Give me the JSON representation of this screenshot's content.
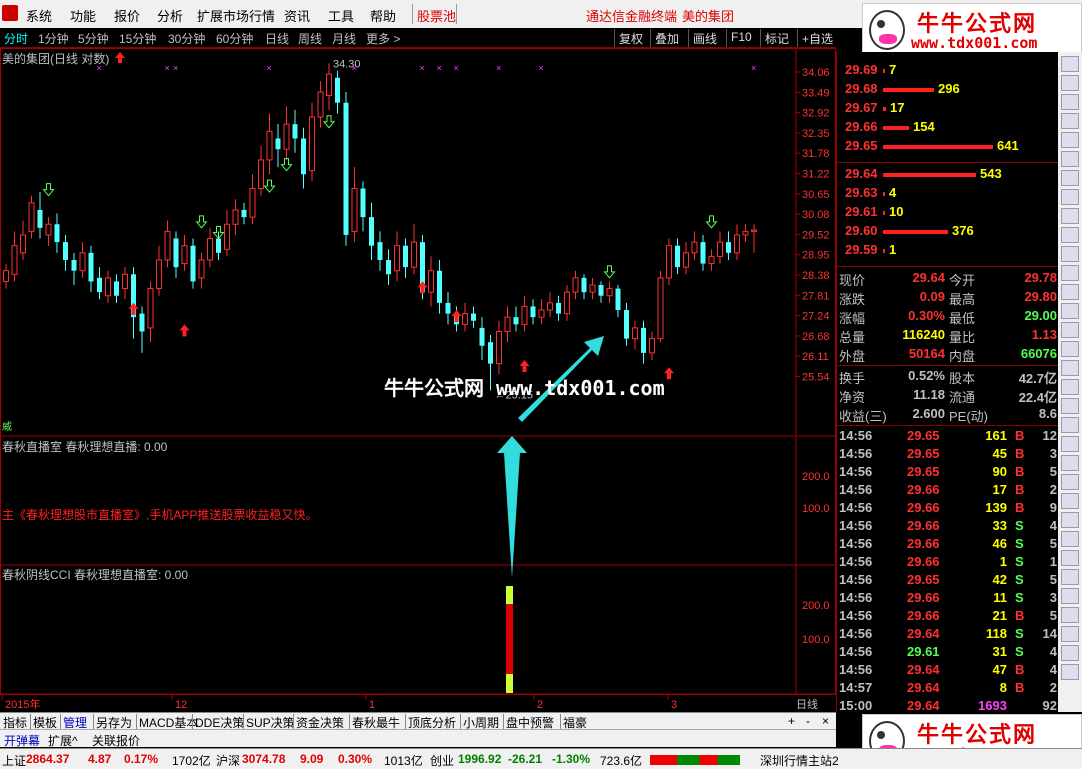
{
  "menu": {
    "items": [
      "系统",
      "功能",
      "报价",
      "分析",
      "扩展市场行情",
      "资讯",
      "工具",
      "帮助"
    ],
    "highlight": "股票池",
    "center_title": "通达信金融终端",
    "stock_name": "美的集团"
  },
  "brand": {
    "title": "牛牛公式网",
    "url": "www.tdx001.com"
  },
  "period_bar": {
    "periods": [
      "分时",
      "1分钟",
      "5分钟",
      "15分钟",
      "30分钟",
      "60分钟",
      "日线",
      "周线",
      "月线",
      "更多 >"
    ],
    "active": "分时",
    "buttons": [
      "复权",
      "叠加",
      "画线",
      "F10",
      "标记",
      "+自选"
    ]
  },
  "chart_title": "美的集团(日线 对数)",
  "watermark": "牛牛公式网 www.tdx001.com",
  "chart_data": {
    "type": "candlestick",
    "price_axis": [
      "34.06",
      "33.49",
      "32.92",
      "32.35",
      "31.78",
      "31.22",
      "30.65",
      "30.08",
      "29.52",
      "28.95",
      "28.38",
      "27.81",
      "27.24",
      "26.68",
      "26.11",
      "25.54"
    ],
    "high_label": "34.30",
    "low_label": "25.15",
    "indicator1": {
      "title": "春秋直播室  春秋理想直播: 0.00",
      "axis": [
        "200.0",
        "100.0"
      ]
    },
    "indicator2": {
      "title": "春秋阴线CCI  春秋理想直播室: 0.00",
      "axis": [
        "200.0",
        "100.0"
      ]
    },
    "x_labels": [
      "2015年",
      "12",
      "1",
      "2",
      "3"
    ],
    "period_label": "日线"
  },
  "promo_text": "主《春秋理想股市直播室》,手机APP推送股票收益稳又快。",
  "order_book": {
    "asks": [
      {
        "price": "29.69",
        "vol": "7"
      },
      {
        "price": "29.68",
        "vol": "296"
      },
      {
        "price": "29.67",
        "vol": "17"
      },
      {
        "price": "29.66",
        "vol": "154"
      },
      {
        "price": "29.65",
        "vol": "641"
      }
    ],
    "bids": [
      {
        "price": "29.64",
        "vol": "543"
      },
      {
        "price": "29.63",
        "vol": "4"
      },
      {
        "price": "29.61",
        "vol": "10"
      },
      {
        "price": "29.60",
        "vol": "376"
      },
      {
        "price": "29.59",
        "vol": "1"
      }
    ]
  },
  "quote": {
    "rows": [
      {
        "l1": "现价",
        "v1": "29.64",
        "l2": "今开",
        "v2": "29.78"
      },
      {
        "l1": "涨跌",
        "v1": "0.09",
        "l2": "最高",
        "v2": "29.80"
      },
      {
        "l1": "涨幅",
        "v1": "0.30%",
        "l2": "最低",
        "v2": "29.00"
      },
      {
        "l1": "总量",
        "v1": "116240",
        "l2": "量比",
        "v2": "1.13"
      },
      {
        "l1": "外盘",
        "v1": "50164",
        "l2": "内盘",
        "v2": "66076"
      }
    ],
    "rows2": [
      {
        "l1": "换手",
        "v1": "0.52%",
        "l2": "股本",
        "v2": "42.7亿"
      },
      {
        "l1": "净资",
        "v1": "11.18",
        "l2": "流通",
        "v2": "22.4亿"
      },
      {
        "l1": "收益(三)",
        "v1": "2.600",
        "l2": "PE(动)",
        "v2": "8.6"
      }
    ]
  },
  "ticks": [
    {
      "t": "14:56",
      "p": "29.65",
      "v": "161",
      "bs": "B",
      "n": "12"
    },
    {
      "t": "14:56",
      "p": "29.65",
      "v": "45",
      "bs": "B",
      "n": "3"
    },
    {
      "t": "14:56",
      "p": "29.65",
      "v": "90",
      "bs": "B",
      "n": "5"
    },
    {
      "t": "14:56",
      "p": "29.66",
      "v": "17",
      "bs": "B",
      "n": "2"
    },
    {
      "t": "14:56",
      "p": "29.66",
      "v": "139",
      "bs": "B",
      "n": "9"
    },
    {
      "t": "14:56",
      "p": "29.66",
      "v": "33",
      "bs": "S",
      "n": "4"
    },
    {
      "t": "14:56",
      "p": "29.66",
      "v": "46",
      "bs": "S",
      "n": "5"
    },
    {
      "t": "14:56",
      "p": "29.66",
      "v": "1",
      "bs": "S",
      "n": "1"
    },
    {
      "t": "14:56",
      "p": "29.65",
      "v": "42",
      "bs": "S",
      "n": "5"
    },
    {
      "t": "14:56",
      "p": "29.66",
      "v": "11",
      "bs": "S",
      "n": "3"
    },
    {
      "t": "14:56",
      "p": "29.66",
      "v": "21",
      "bs": "B",
      "n": "5"
    },
    {
      "t": "14:56",
      "p": "29.64",
      "v": "118",
      "bs": "S",
      "n": "14"
    },
    {
      "t": "14:56",
      "p": "29.61",
      "v": "31",
      "bs": "S",
      "n": "4"
    },
    {
      "t": "14:56",
      "p": "29.64",
      "v": "47",
      "bs": "B",
      "n": "4"
    },
    {
      "t": "14:57",
      "p": "29.64",
      "v": "8",
      "bs": "B",
      "n": "2"
    },
    {
      "t": "15:00",
      "p": "29.64",
      "v": "1693",
      "bs": "",
      "n": "92"
    }
  ],
  "bottom_tabs": [
    "指标",
    "模板",
    "管理",
    "另存为",
    "MACD基本",
    "DDE决策",
    "SUP决策",
    "资金决策",
    "春秋最牛",
    "顶底分析",
    "小周期",
    "盘中预警",
    "福豪"
  ],
  "bottom_tabs_active": "管理",
  "bottom_tabs2": [
    "开弹幕",
    "扩展^",
    "关联报价"
  ],
  "status": {
    "sh_label": "上证",
    "sh_val": "2864.37",
    "sh_chg": "4.87",
    "sh_pct": "0.17%",
    "sh_amt": "1702亿",
    "sz_label": "沪深",
    "sz_val": "3074.78",
    "sz_chg": "9.09",
    "sz_pct": "0.30%",
    "sz_amt": "1013亿",
    "cy_label": "创业",
    "cy_val": "1996.92",
    "cy_chg": "-26.21",
    "cy_pct": "-1.30%",
    "cy_amt": "723.6亿",
    "server": "深圳行情主站2"
  }
}
